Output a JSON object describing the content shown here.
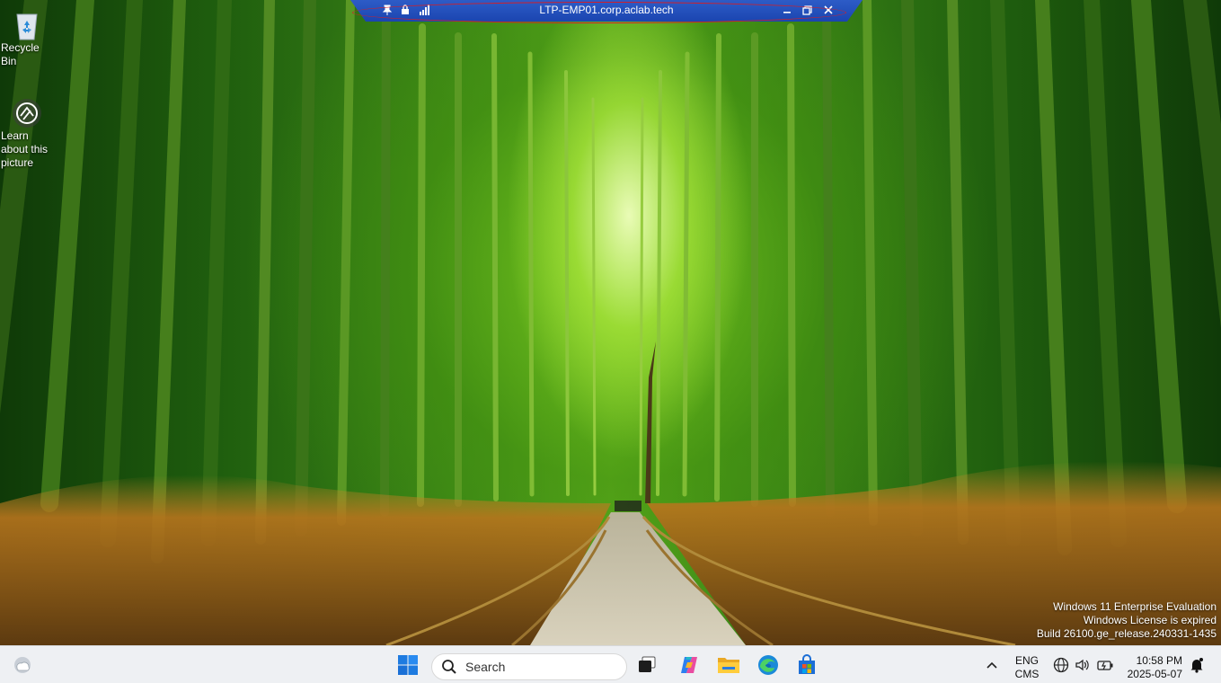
{
  "desktop": {
    "icons": [
      {
        "label": "Recycle Bin"
      },
      {
        "label": "Learn about this picture"
      }
    ]
  },
  "rdp_bar": {
    "title": "LTP-EMP01.corp.aclab.tech"
  },
  "watermark": {
    "line1": "Windows 11 Enterprise Evaluation",
    "line2": "Windows License is expired",
    "line3": "Build 26100.ge_release.240331-1435"
  },
  "taskbar": {
    "search_placeholder": "Search",
    "pinned_apps": [
      "task-view",
      "copilot",
      "file-explorer",
      "edge",
      "microsoft-store"
    ],
    "tray": {
      "lang_line1": "ENG",
      "lang_line2": "CMS",
      "time": "10:58 PM",
      "date": "2025-05-07"
    }
  },
  "colors": {
    "rdp_bar": "#1b45b0",
    "rdp_outline": "#d0202a",
    "taskbar_bg": "#eef0f3",
    "win_blue": "#1e7be0"
  }
}
